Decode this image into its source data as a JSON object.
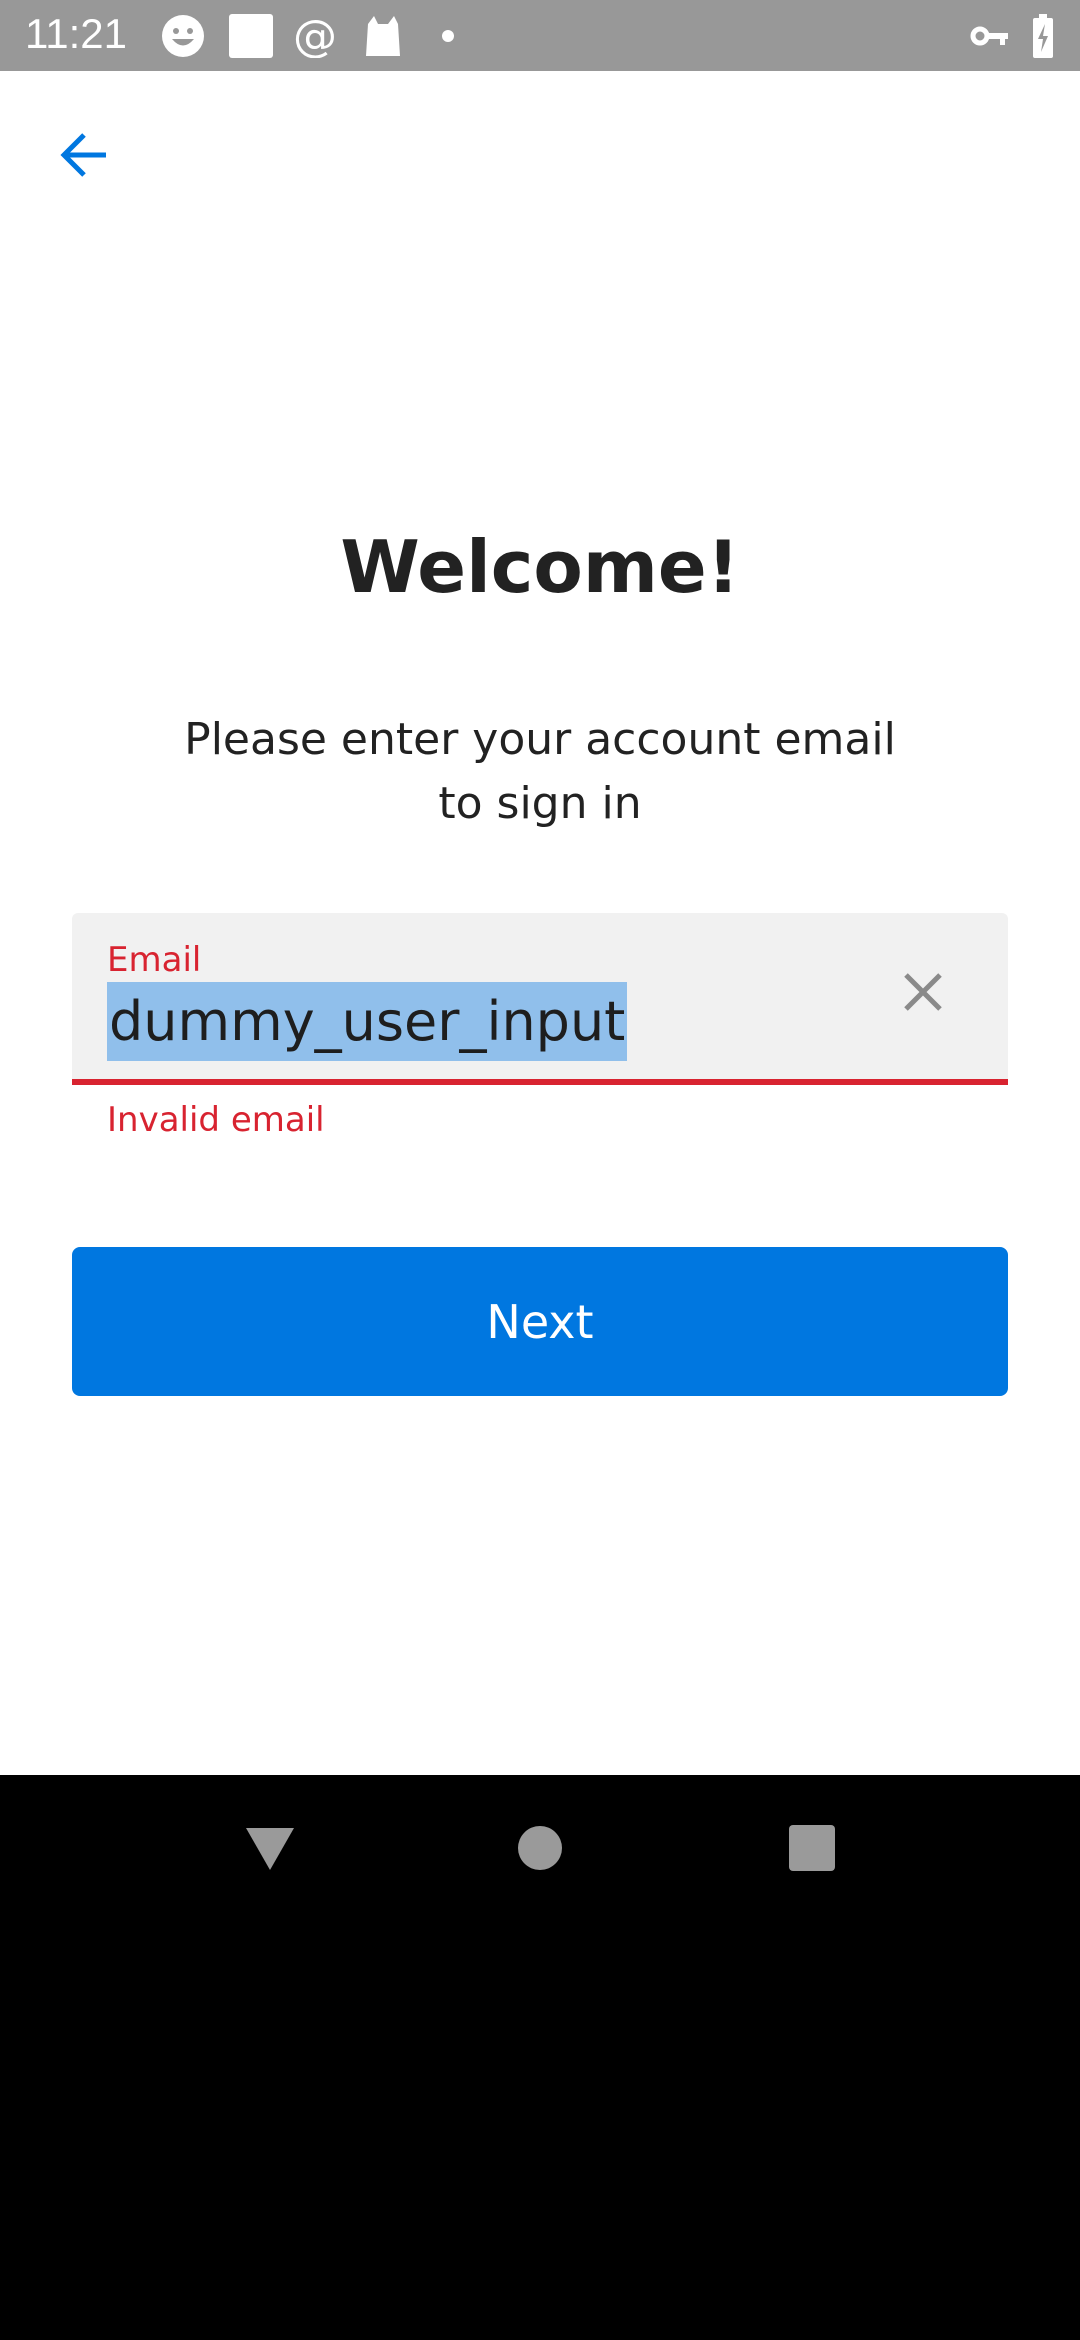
{
  "status_bar": {
    "time": "11:21",
    "icons": [
      "smiley-icon",
      "square-icon",
      "at-icon",
      "cat-icon",
      "dot-icon",
      "vpn-key-icon",
      "battery-charging-icon"
    ]
  },
  "header": {
    "back_icon": "arrow-left-icon"
  },
  "main": {
    "title": "Welcome!",
    "subtitle_line1": "Please enter your account email",
    "subtitle_line2": "to sign in",
    "email_field": {
      "label": "Email",
      "value": "dummy_user_input",
      "error": "Invalid email"
    },
    "next_label": "Next"
  },
  "colors": {
    "accent": "#0077e0",
    "error": "#d82330",
    "selection": "#90bfeb"
  }
}
